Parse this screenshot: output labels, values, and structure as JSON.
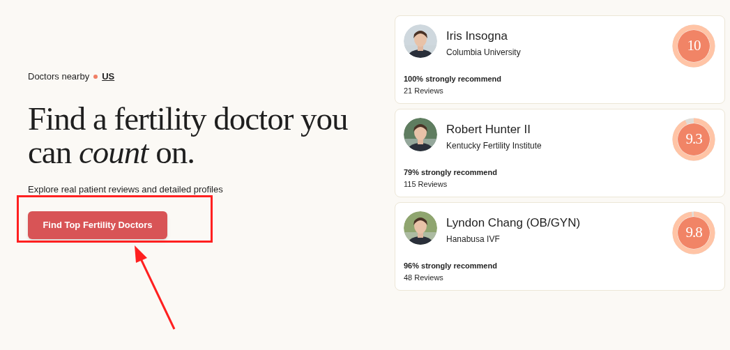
{
  "hero": {
    "location_label": "Doctors nearby",
    "location": "US",
    "headline": "Find a fertility doctor you can *count* on.",
    "subtitle": "Explore real patient reviews and detailed profiles",
    "cta": "Find Top Fertility Doctors"
  },
  "doctors": [
    {
      "name": "Iris Insogna",
      "institution": "Columbia University",
      "recommend": "100% strongly recommend",
      "reviews": "21 Reviews",
      "score": "10",
      "level": 1
    },
    {
      "name": "Robert Hunter II",
      "institution": "Kentucky Fertility Institute",
      "recommend": "79% strongly recommend",
      "reviews": "115 Reviews",
      "score": "9.3",
      "level": 0.93
    },
    {
      "name": "Lyndon Chang (OB/GYN)",
      "institution": "Hanabusa IVF",
      "recommend": "96% strongly recommend",
      "reviews": "48 Reviews",
      "score": "9.8",
      "level": 0.98
    }
  ]
}
